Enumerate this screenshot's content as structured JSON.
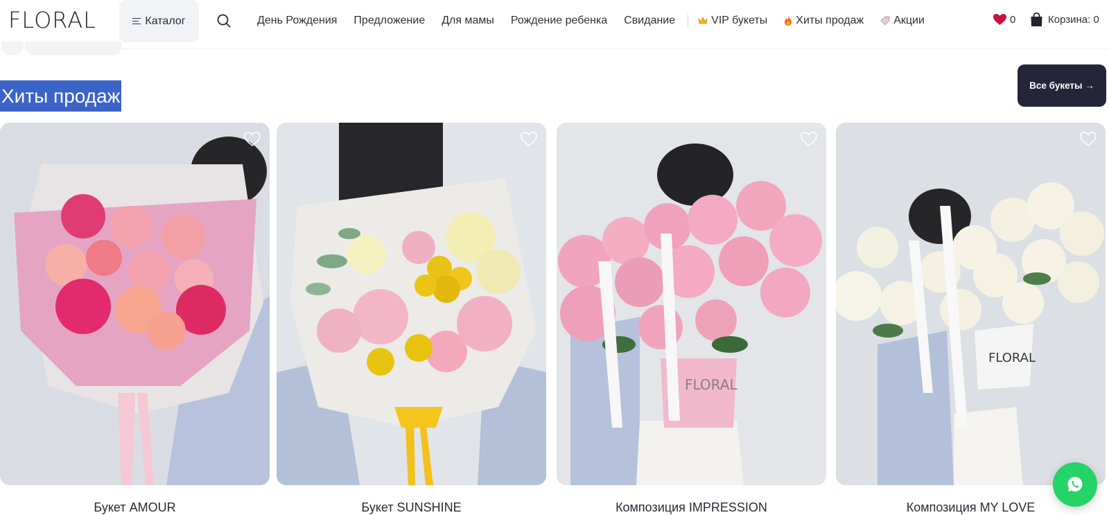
{
  "header": {
    "logo": "FLORAL",
    "catalog_label": "Каталог",
    "nav": [
      {
        "label": "День Рождения",
        "icon": ""
      },
      {
        "label": "Предложение",
        "icon": ""
      },
      {
        "label": "Для мамы",
        "icon": ""
      },
      {
        "label": "Рождение ребенка",
        "icon": ""
      },
      {
        "label": "Свидание",
        "icon": ""
      },
      {
        "label": "VIP букеты",
        "icon": "crown-icon"
      },
      {
        "label": "Хиты продаж",
        "icon": "fire-icon"
      },
      {
        "label": "Акции",
        "icon": "tag-icon"
      }
    ],
    "favorites_count": "0",
    "cart_label": "Корзина: 0"
  },
  "section": {
    "title": "Хиты продаж",
    "all_button": "Все букеты →"
  },
  "products": [
    {
      "name": "Букет AMOUR",
      "palette": "pink"
    },
    {
      "name": "Букет SUNSHINE",
      "palette": "mixed"
    },
    {
      "name": "Композиция IMPRESSION",
      "palette": "rose"
    },
    {
      "name": "Композиция MY LOVE",
      "palette": "white"
    }
  ],
  "colors": {
    "selection": "#3c64c8",
    "dark_button": "#25253a",
    "heart": "#c8143c",
    "whatsapp": "#26d367"
  }
}
